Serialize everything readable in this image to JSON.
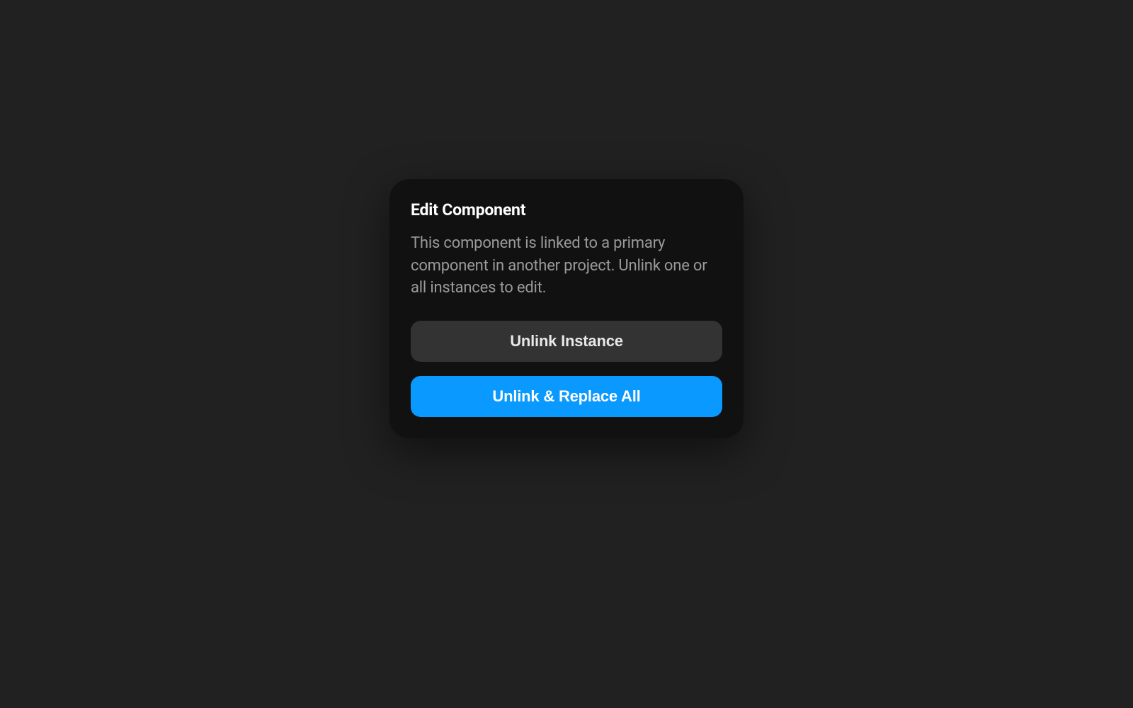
{
  "dialog": {
    "title": "Edit Component",
    "body": "This component is linked to a primary component in another project. Unlink one or all instances to edit.",
    "buttons": {
      "secondary": "Unlink Instance",
      "primary": "Unlink & Replace All"
    }
  }
}
